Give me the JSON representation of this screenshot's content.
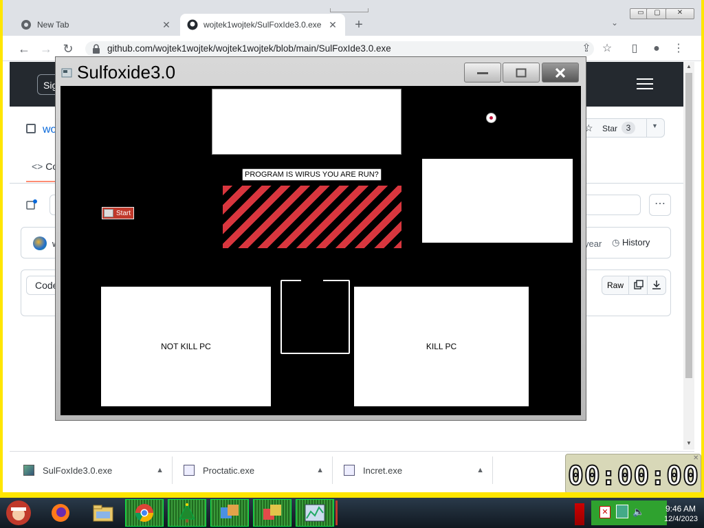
{
  "browser": {
    "tabs": [
      {
        "title": "New Tab",
        "active": false
      },
      {
        "title": "wojtek1wojtek/SulFoxIde3.0.exe",
        "active": true
      }
    ],
    "url": "github.com/wojtek1wojtek/wojtek1wojtek/blob/main/SulFoxIde3.0.exe",
    "window_buttons": {
      "minimize": "▭",
      "maximize": "▢",
      "close": "✕"
    }
  },
  "github": {
    "sign_label": "Sig",
    "repo_name": "wo",
    "star_label": "Star",
    "star_count": "3",
    "code_tab": "Co",
    "year_text": "year",
    "history_label": "History",
    "code_button": "Code",
    "raw_button": "Raw",
    "commit_user": "w"
  },
  "sulfoxide": {
    "title": "Sulfoxide3.0",
    "prompt": "PROGRAM IS WIRUS YOU ARE RUN?",
    "start_label": "Start",
    "not_kill_label": "NOT KILL PC",
    "kill_label": "KILL PC"
  },
  "downloads": [
    {
      "name": "SulFoxIde3.0.exe"
    },
    {
      "name": "Proctatic.exe"
    },
    {
      "name": "Incret.exe"
    }
  ],
  "timer": {
    "value": "00:00:00"
  },
  "taskbar": {
    "time": "9:46 AM",
    "date": "12/4/2023"
  },
  "colors": {
    "stripe_red": "#d9363e",
    "github_header": "#24292f",
    "border_yellow": "#ffe600"
  }
}
